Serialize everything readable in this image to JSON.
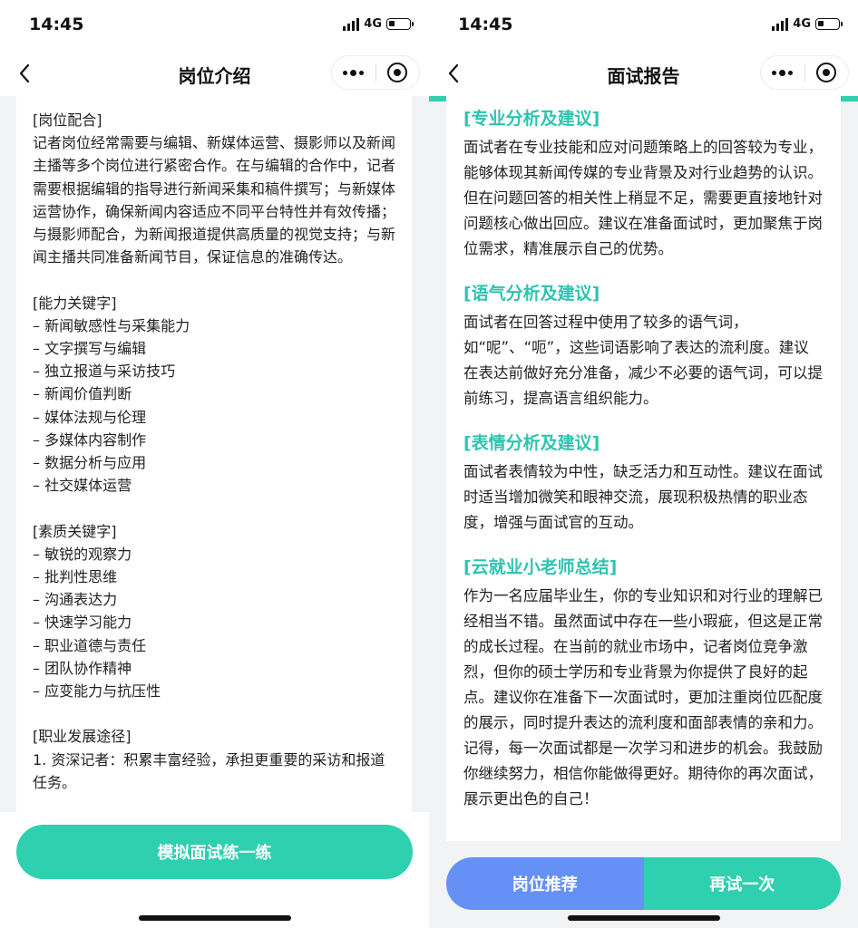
{
  "status": {
    "time": "14:45",
    "network": "4G"
  },
  "left": {
    "nav_title": "岗位介绍",
    "paragraphs": [
      "[岗位配合]",
      "记者岗位经常需要与编辑、新媒体运营、摄影师以及新闻主播等多个岗位进行紧密合作。在与编辑的合作中，记者需要根据编辑的指导进行新闻采集和稿件撰写；与新媒体运营协作，确保新闻内容适应不同平台特性并有效传播；与摄影师配合，为新闻报道提供高质量的视觉支持；与新闻主播共同准备新闻节目，保证信息的准确传达。",
      "",
      "[能力关键字]",
      "– 新闻敏感性与采集能力",
      "– 文字撰写与编辑",
      "– 独立报道与采访技巧",
      "– 新闻价值判断",
      "– 媒体法规与伦理",
      "– 多媒体内容制作",
      "– 数据分析与应用",
      "– 社交媒体运营",
      "",
      "[素质关键字]",
      "– 敏锐的观察力",
      "– 批判性思维",
      "– 沟通表达力",
      "– 快速学习能力",
      "– 职业道德与责任",
      "– 团队协作精神",
      "– 应变能力与抗压性",
      "",
      "[职业发展途径]",
      "1. 资深记者：积累丰富经验，承担更重要的采访和报道任务。"
    ],
    "practice_button": "模拟面试练一练"
  },
  "right": {
    "nav_title": "面试报告",
    "sections": [
      {
        "title": "[专业分析及建议]",
        "body": "面试者在专业技能和应对问题策略上的回答较为专业，能够体现其新闻传媒的专业背景及对行业趋势的认识。但在问题回答的相关性上稍显不足，需要更直接地针对问题核心做出回应。建议在准备面试时，更加聚焦于岗位需求，精准展示自己的优势。"
      },
      {
        "title": "[语气分析及建议]",
        "body": "面试者在回答过程中使用了较多的语气词，如“呢”、“呃”，这些词语影响了表达的流利度。建议在表达前做好充分准备，减少不必要的语气词，可以提前练习，提高语言组织能力。"
      },
      {
        "title": "[表情分析及建议]",
        "body": "面试者表情较为中性，缺乏活力和互动性。建议在面试时适当增加微笑和眼神交流，展现积极热情的职业态度，增强与面试官的互动。"
      },
      {
        "title": "[云就业小老师总结]",
        "body": "作为一名应届毕业生，你的专业知识和对行业的理解已经相当不错。虽然面试中存在一些小瑕疵，但这是正常的成长过程。在当前的就业市场中，记者岗位竞争激烈，但你的硕士学历和专业背景为你提供了良好的起点。建议你在准备下一次面试时，更加注重岗位匹配度的展示，同时提升表达的流利度和面部表情的亲和力。记得，每一次面试都是一次学习和进步的机会。我鼓励你继续努力，相信你能做得更好。期待你的再次面试，展示更出色的自己！"
      }
    ],
    "recommend_button": "岗位推荐",
    "retry_button": "再试一次"
  },
  "colors": {
    "accent_teal": "#2ed0b0",
    "accent_blue": "#6590f5",
    "section_title": "#2ec4b0"
  }
}
